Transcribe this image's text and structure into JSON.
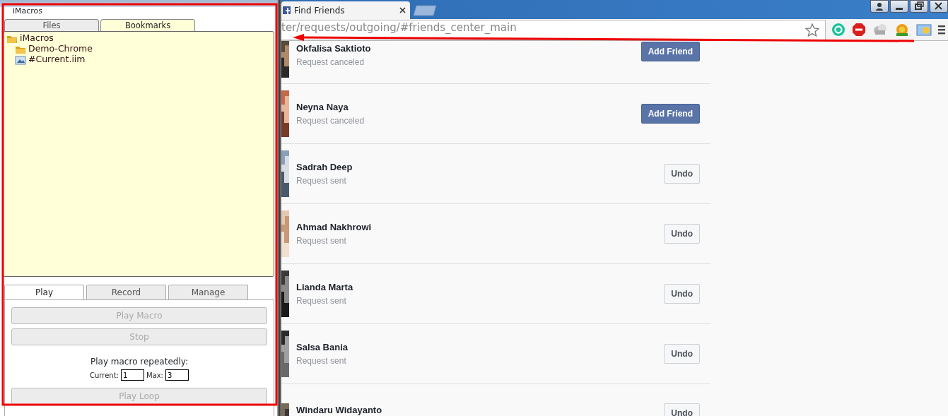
{
  "imacros": {
    "title": "iMacros",
    "top_tabs": [
      {
        "label": "Files",
        "selected": false
      },
      {
        "label": "Bookmarks",
        "selected": true
      }
    ],
    "tree": [
      {
        "label": "iMacros",
        "kind": "folder",
        "children": [
          {
            "label": "Demo-Chrome",
            "kind": "folder"
          },
          {
            "label": "#Current.iim",
            "kind": "macro"
          }
        ]
      }
    ],
    "bottom_tabs": [
      {
        "label": "Play",
        "selected": true
      },
      {
        "label": "Record",
        "selected": false
      },
      {
        "label": "Manage",
        "selected": false
      }
    ],
    "buttons": [
      {
        "label": "Play Macro",
        "disabled": true
      },
      {
        "label": "Stop",
        "disabled": true
      }
    ],
    "repeat_label": "Play macro repeatedly:",
    "current_label": "Current:",
    "current_value": "1",
    "max_label": "Max:",
    "max_value": "3",
    "loop_button": {
      "label": "Play Loop",
      "disabled": true
    }
  },
  "browser": {
    "tab": {
      "title": "Find Friends"
    },
    "url": "ter/requests/outgoing/#friends_center_main",
    "requests": [
      {
        "name": "Okfalisa Saktioto",
        "status": "Request canceled",
        "action": {
          "label": "Add Friend",
          "kind": "add"
        }
      },
      {
        "name": "Neyna Naya",
        "status": "Request canceled",
        "action": {
          "label": "Add Friend",
          "kind": "add"
        }
      },
      {
        "name": "Sadrah Deep",
        "status": "Request sent",
        "action": {
          "label": "Undo",
          "kind": "undo"
        }
      },
      {
        "name": "Ahmad Nakhrowi",
        "status": "Request sent",
        "action": {
          "label": "Undo",
          "kind": "undo"
        }
      },
      {
        "name": "Lianda Marta",
        "status": "Request sent",
        "action": {
          "label": "Undo",
          "kind": "undo"
        }
      },
      {
        "name": "Salsa Bania",
        "status": "Request sent",
        "action": {
          "label": "Undo",
          "kind": "undo"
        }
      },
      {
        "name": "Windaru Widayanto",
        "action": {
          "label": "Undo",
          "kind": "undo"
        }
      }
    ]
  }
}
